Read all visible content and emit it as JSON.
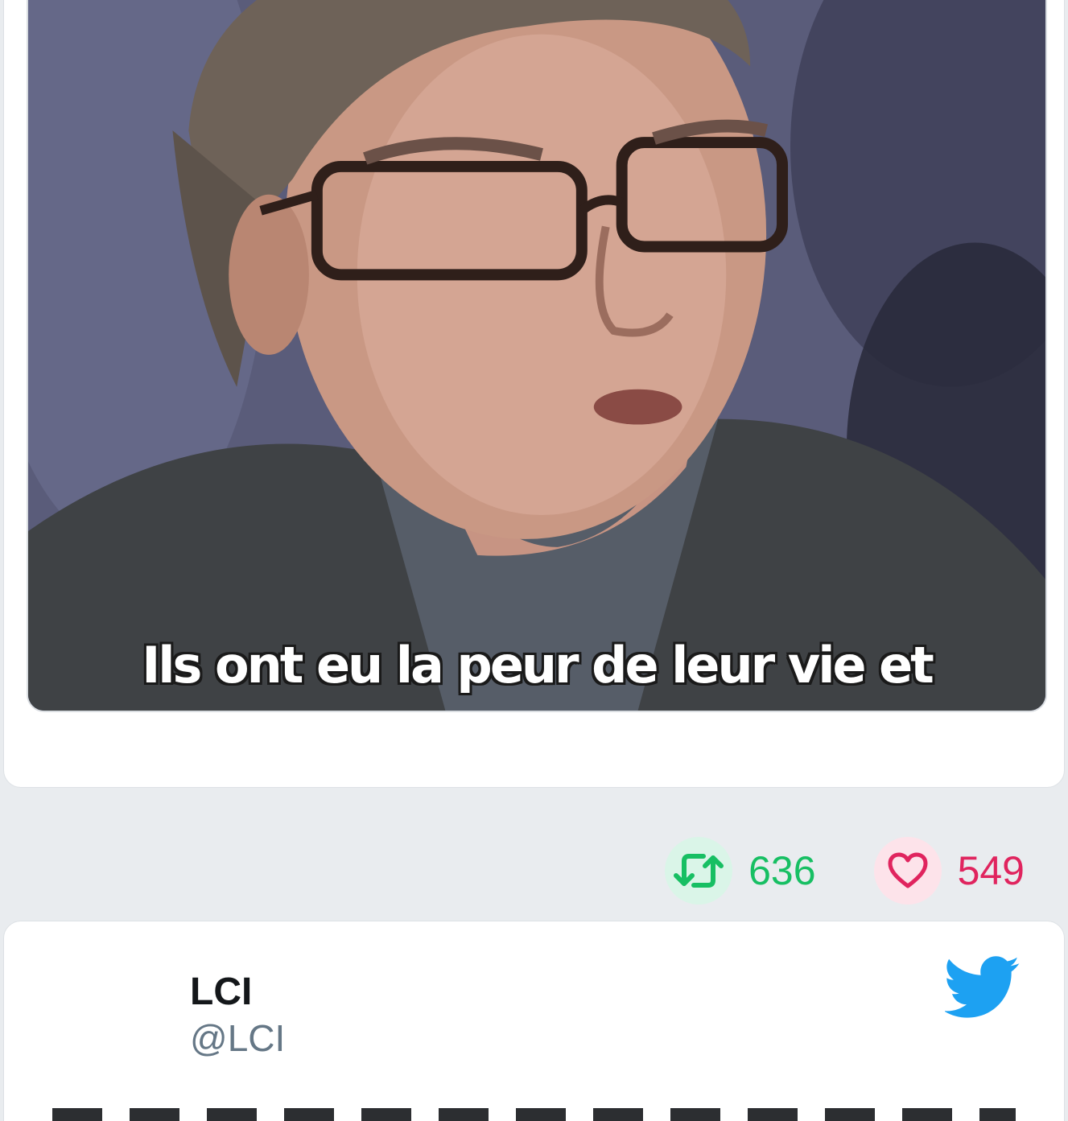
{
  "media": {
    "subtitle": "Ils ont eu la peur de leur vie et"
  },
  "actions": {
    "retweet_icon": "retweet-icon",
    "retweet_count": "636",
    "like_icon": "heart-icon",
    "like_count": "549",
    "retweet_color": "#17bf63",
    "like_color": "#e0245e"
  },
  "tweet": {
    "author_name": "LCI",
    "author_handle": "@LCI",
    "platform_icon": "twitter-bird-icon",
    "brand_color": "#1da1f2"
  }
}
